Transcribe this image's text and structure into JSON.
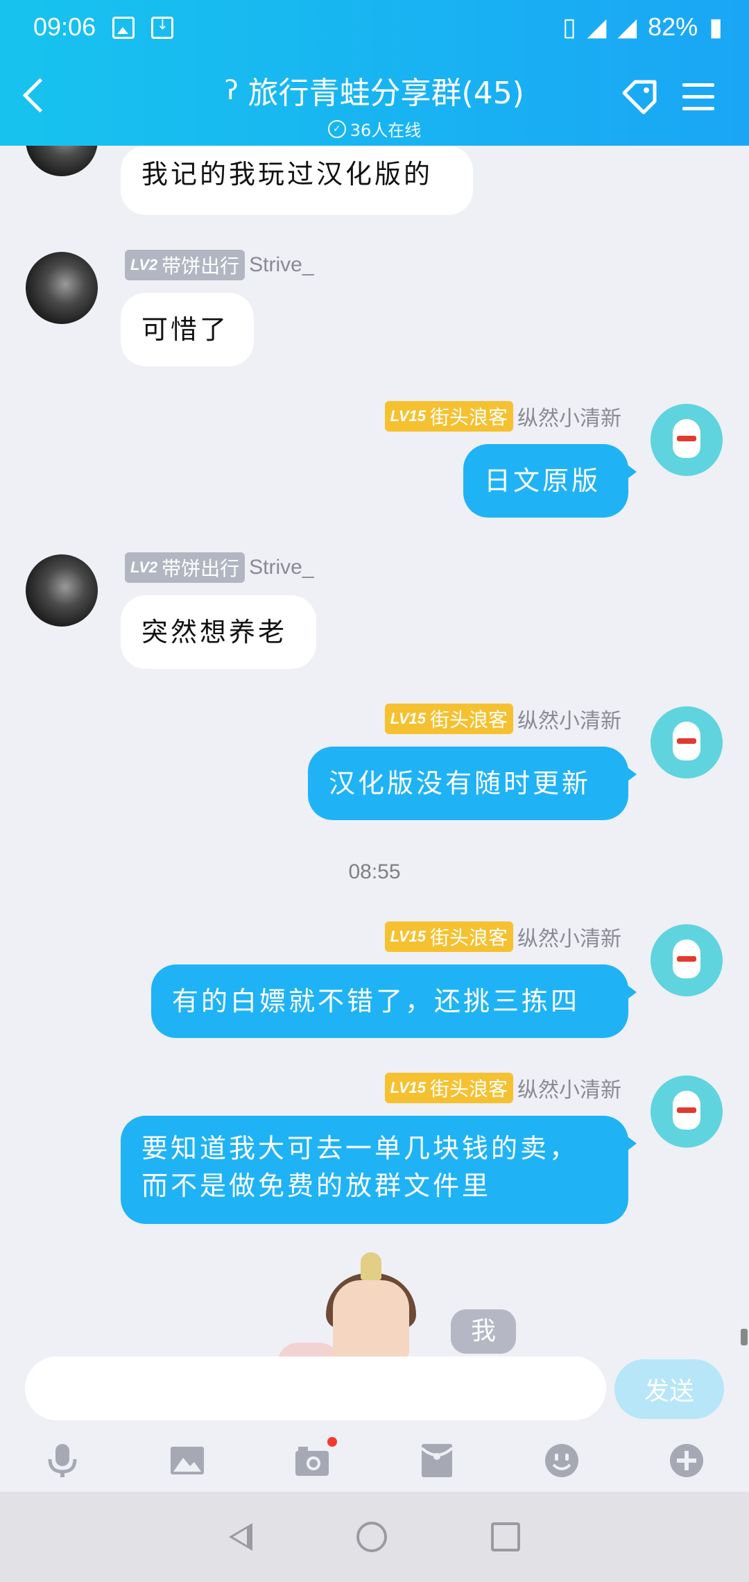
{
  "status_bar": {
    "time": "09:06",
    "battery": "82%"
  },
  "header": {
    "title": "旅行青蛙分享群(45)",
    "online": "36人在线"
  },
  "messages": [
    {
      "side": "in",
      "text": "我记的我玩过汉化版的"
    },
    {
      "side": "in",
      "badge_level": "LV2",
      "badge_title": "带饼出行",
      "name": "Strive_",
      "text": "可惜了"
    },
    {
      "side": "out",
      "badge_level": "LV15",
      "badge_title": "街头浪客",
      "name": "纵然小清新",
      "text": "日文原版"
    },
    {
      "side": "in",
      "badge_level": "LV2",
      "badge_title": "带饼出行",
      "name": "Strive_",
      "text": "突然想养老"
    },
    {
      "side": "out",
      "badge_level": "LV15",
      "badge_title": "街头浪客",
      "name": "纵然小清新",
      "text": "汉化版没有随时更新"
    },
    {
      "side": "out",
      "badge_level": "LV15",
      "badge_title": "街头浪客",
      "name": "纵然小清新",
      "text": "有的白嫖就不错了，还挑三拣四"
    },
    {
      "side": "out",
      "badge_level": "LV15",
      "badge_title": "街头浪客",
      "name": "纵然小清新",
      "text_line1": "要知道我大可去一单几块钱的卖，",
      "text_line2": "而不是做免费的放群文件里"
    }
  ],
  "time_separator": "08:55",
  "sticker_label": "我",
  "input": {
    "placeholder": "",
    "send_label": "发送"
  },
  "toolbar": [
    "mic-icon",
    "image-icon",
    "camera-icon",
    "red-packet-icon",
    "emoji-icon",
    "plus-icon"
  ],
  "colors": {
    "header_start": "#17c3ee",
    "header_end": "#1aa6f5",
    "bubble_out": "#1fb3f5",
    "badge_gold": "#f5c130",
    "badge_gray": "#b2b6c2"
  }
}
